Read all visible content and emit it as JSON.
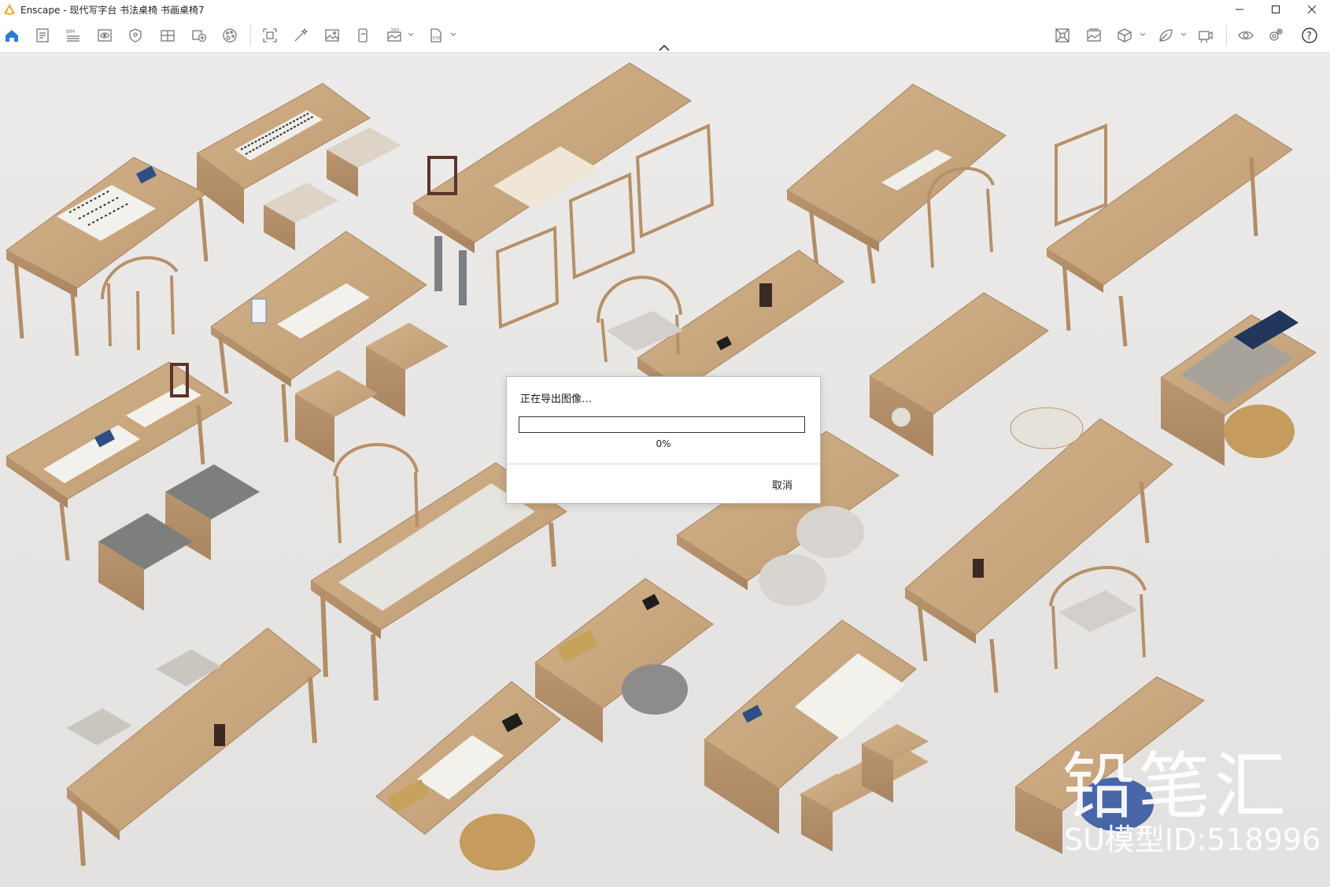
{
  "window": {
    "title": "Enscape - 现代写字台 书法桌椅 书画桌椅7",
    "controls": [
      "minimize-icon",
      "maximize-icon",
      "close-icon"
    ]
  },
  "toolbar": {
    "left_icons": [
      "home-icon",
      "document-icon",
      "bim-icon",
      "view-icon",
      "shield-icon",
      "grid-icon",
      "add-view-icon",
      "palette-icon",
      "screenshot-icon",
      "magic-wand-icon",
      "image-icon",
      "phone-icon",
      "panorama-360-icon",
      "export-exe-icon"
    ],
    "bim_label": "BIM",
    "right_icons": [
      "asset-library-icon",
      "image-gallery-icon",
      "cube-icon",
      "leaf-icon",
      "camera-icon",
      "eye-icon",
      "settings-icon",
      "help-icon"
    ],
    "help_label": "?"
  },
  "dialog": {
    "message": "正在导出图像…",
    "progress": 0,
    "progress_text": "0%",
    "cancel_label": "取消"
  },
  "watermark": {
    "brand": "铅笔汇",
    "model_id": "SU模型ID:518996"
  },
  "colors": {
    "accent": "#2e7bd6",
    "logo": "#f2a52a",
    "wood": "#c9a67e",
    "background": "#e9e6e3"
  }
}
